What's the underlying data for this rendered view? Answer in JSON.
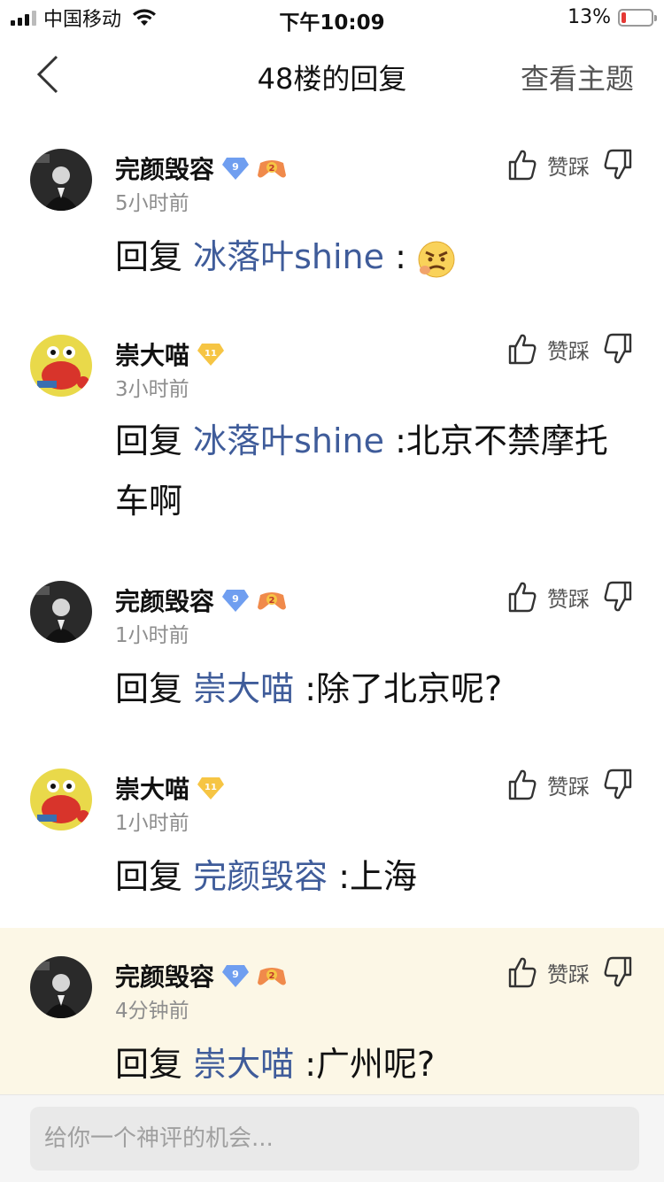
{
  "status_bar": {
    "carrier": "中国移动",
    "time": "下午10:09",
    "battery": "13%",
    "battery_color": "#e53935"
  },
  "nav": {
    "back_icon": "chevron-left-icon",
    "title": "48楼的回复",
    "right_link": "查看主题"
  },
  "colors": {
    "mention": "#3f5c9a",
    "highlight_bg": "#fcf7e6",
    "level_badge_blue": "#6f9ef0",
    "level_badge_gold": "#f6c544"
  },
  "comments": [
    {
      "user": "完颜毁容",
      "level": "9",
      "level_badge": "blue-diamond",
      "extra_badge": "gamepad-2",
      "time": "5小时前",
      "reply_prefix": "回复 ",
      "mention": "冰落叶shine",
      "separator": " :",
      "text": "",
      "emoji": "angry-face-emoji",
      "action_label": "赞踩",
      "avatar": "bw-man-avatar"
    },
    {
      "user": "崇大喵",
      "level": "11",
      "level_badge": "gold-diamond",
      "time": "3小时前",
      "reply_prefix": "回复 ",
      "mention": "冰落叶shine",
      "separator": " :",
      "text": "北京不禁摩托车啊",
      "action_label": "赞踩",
      "avatar": "crab-cartoon-avatar"
    },
    {
      "user": "完颜毁容",
      "level": "9",
      "level_badge": "blue-diamond",
      "extra_badge": "gamepad-2",
      "time": "1小时前",
      "reply_prefix": "回复 ",
      "mention": "崇大喵",
      "separator": " :",
      "text": "除了北京呢?",
      "action_label": "赞踩",
      "avatar": "bw-man-avatar"
    },
    {
      "user": "崇大喵",
      "level": "11",
      "level_badge": "gold-diamond",
      "time": "1小时前",
      "reply_prefix": "回复 ",
      "mention": "完颜毁容",
      "separator": " :",
      "text": "上海",
      "action_label": "赞踩",
      "avatar": "crab-cartoon-avatar"
    },
    {
      "user": "完颜毁容",
      "level": "9",
      "level_badge": "blue-diamond",
      "extra_badge": "gamepad-2",
      "time": "4分钟前",
      "reply_prefix": "回复 ",
      "mention": "崇大喵",
      "separator": " :",
      "text": "广州呢?",
      "action_label": "赞踩",
      "avatar": "bw-man-avatar",
      "highlighted": true
    }
  ],
  "input": {
    "placeholder": "给你一个神评的机会..."
  }
}
